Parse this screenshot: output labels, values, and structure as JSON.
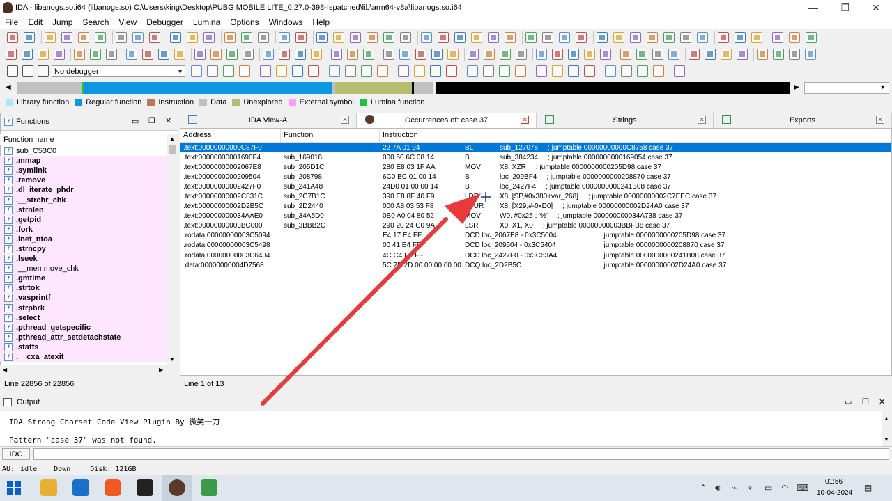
{
  "window": {
    "title": "IDA - libanogs.so.i64 (libanogs.so) C:\\Users\\king\\Desktop\\PUBG MOBILE LITE_0.27.0-398-Ispatched\\lib\\arm64-v8a\\libanogs.so.i64"
  },
  "menu": [
    "File",
    "Edit",
    "Jump",
    "Search",
    "View",
    "Debugger",
    "Lumina",
    "Options",
    "Windows",
    "Help"
  ],
  "debugger_select": "No debugger",
  "legend": [
    {
      "label": "Library function",
      "color": "#a8e8ff"
    },
    {
      "label": "Regular function",
      "color": "#0a96e0"
    },
    {
      "label": "Instruction",
      "color": "#b47a5a"
    },
    {
      "label": "Data",
      "color": "#c0c0c0"
    },
    {
      "label": "Unexplored",
      "color": "#b8bc70"
    },
    {
      "label": "External symbol",
      "color": "#ff9cff"
    },
    {
      "label": "Lumina function",
      "color": "#20c040"
    }
  ],
  "functions_panel": {
    "title": "Functions",
    "column": "Function name",
    "items": [
      {
        "name": "sub_C53C0",
        "lib": false
      },
      {
        "name": ".mmap",
        "lib": true
      },
      {
        "name": ".symlink",
        "lib": true
      },
      {
        "name": ".remove",
        "lib": true
      },
      {
        "name": ".dl_iterate_phdr",
        "lib": true
      },
      {
        "name": ".__strchr_chk",
        "lib": true
      },
      {
        "name": ".strnlen",
        "lib": true
      },
      {
        "name": ".getpid",
        "lib": true
      },
      {
        "name": ".fork",
        "lib": true
      },
      {
        "name": ".inet_ntoa",
        "lib": true
      },
      {
        "name": ".strncpy",
        "lib": true
      },
      {
        "name": ".lseek",
        "lib": true
      },
      {
        "name": ".__memmove_chk",
        "lib": true,
        "normal": true
      },
      {
        "name": ".gmtime",
        "lib": true
      },
      {
        "name": ".strtok",
        "lib": true
      },
      {
        "name": ".vasprintf",
        "lib": true
      },
      {
        "name": ".strpbrk",
        "lib": true
      },
      {
        "name": ".select",
        "lib": true
      },
      {
        "name": ".pthread_getspecific",
        "lib": true
      },
      {
        "name": ".pthread_attr_setdetachstate",
        "lib": true
      },
      {
        "name": ".statfs",
        "lib": true
      },
      {
        "name": ".__cxa_atexit",
        "lib": true
      }
    ],
    "status": "Line 22856 of 22856"
  },
  "tabs": [
    {
      "label": "IDA View-A",
      "active": false
    },
    {
      "label": "Occurrences of: case 37",
      "active": true
    },
    {
      "label": "Strings",
      "active": false
    },
    {
      "label": "Exports",
      "active": false
    }
  ],
  "occurrences": {
    "headers": [
      "Address",
      "Function",
      "Instruction"
    ],
    "rows": [
      {
        "addr": ".text:00000000000C87F0",
        "func": "",
        "bytes": "22 7A 01 94",
        "mnem": "BL",
        "ops": "sub_127078",
        "comment": "; jumptable 00000000000C8758 case 37"
      },
      {
        "addr": ".text:00000000001690F4",
        "func": "sub_169018",
        "bytes": "000 50 6C 08 14",
        "mnem": "B",
        "ops": "sub_384234",
        "comment": "; jumptable 0000000000169054 case 37"
      },
      {
        "addr": ".text:00000000002067E8",
        "func": "sub_205D1C",
        "bytes": "280 E8 03 1F AA",
        "mnem": "MOV",
        "ops": "X8, XZR",
        "comment": "; jumptable 0000000000205D98 case 37"
      },
      {
        "addr": ".text:0000000000209504",
        "func": "sub_208798",
        "bytes": "6C0 BC 01 00 14",
        "mnem": "B",
        "ops": "loc_209BF4",
        "comment": "; jumptable 0000000000208870 case 37"
      },
      {
        "addr": ".text:00000000002427F0",
        "func": "sub_241A48",
        "bytes": "24D0 01 00 00 14",
        "mnem": "B",
        "ops": "loc_2427F4",
        "comment": "; jumptable 0000000000241B08 case 37"
      },
      {
        "addr": ".text:00000000002C831C",
        "func": "sub_2C7B1C",
        "bytes": "390 E8 8F 40 F9",
        "mnem": "LDR",
        "ops": "X8, [SP,#0x380+var_268]",
        "comment": "; jumptable 00000000002C7EEC case 37"
      },
      {
        "addr": ".text:00000000002D2B5C",
        "func": "sub_2D2440",
        "bytes": "000 A8 03 53 F8",
        "mnem": "LDUR",
        "ops": "X8, [X29,#-0xD0]",
        "comment": "; jumptable 00000000002D24A0 case 37"
      },
      {
        "addr": ".text:000000000034AAE0",
        "func": "sub_34A5D0",
        "bytes": "0B0 A0 04 80 52",
        "mnem": "MOV",
        "ops": "W0, #0x25 ; '%'",
        "comment": "; jumptable 000000000034A738 case 37"
      },
      {
        "addr": ".text:00000000003BC000",
        "func": "sub_3BBB2C",
        "bytes": "290 20 24 C0 9A",
        "mnem": "LSR",
        "ops": "X0, X1, X0",
        "comment": "; jumptable 00000000003BBFB8 case 37"
      },
      {
        "addr": ".rodata:00000000003C5094",
        "func": "",
        "bytes": "E4 17 E4 FF",
        "mnem": "DCD loc_2067E8 - 0x3C5004",
        "ops": "",
        "comment": "; jumptable 0000000000205D98 case 37"
      },
      {
        "addr": ".rodata:00000000003C5498",
        "func": "",
        "bytes": "00 41 E4 FF",
        "mnem": "DCD loc_209504 - 0x3C5404",
        "ops": "",
        "comment": "; jumptable 0000000000208870 case 37"
      },
      {
        "addr": ".rodata:00000000003C6434",
        "func": "",
        "bytes": "4C C4 E7 FF",
        "mnem": "DCD loc_2427F0 - 0x3C63A4",
        "ops": "",
        "comment": "; jumptable 0000000000241B08 case 37"
      },
      {
        "addr": ".data:00000000004D7568",
        "func": "",
        "bytes": "5C 2B 2D 00 00 00 00 00",
        "mnem": "DCQ loc_2D2B5C",
        "ops": "",
        "comment": "; jumptable 00000000002D24A0 case 37"
      }
    ],
    "status": "Line 1 of 13"
  },
  "output": {
    "title": "Output",
    "line1": "IDA Strong Charset Code View Plugin By 微笑一刀",
    "line2": "Pattern \"case 37\" was not found.",
    "idc_label": "IDC"
  },
  "statusbar": {
    "au": "AU:",
    "state": "idle",
    "dir": "Down",
    "disk": "Disk: 121GB"
  },
  "taskbar": {
    "time": "01:56",
    "date": "10-04-2024"
  }
}
